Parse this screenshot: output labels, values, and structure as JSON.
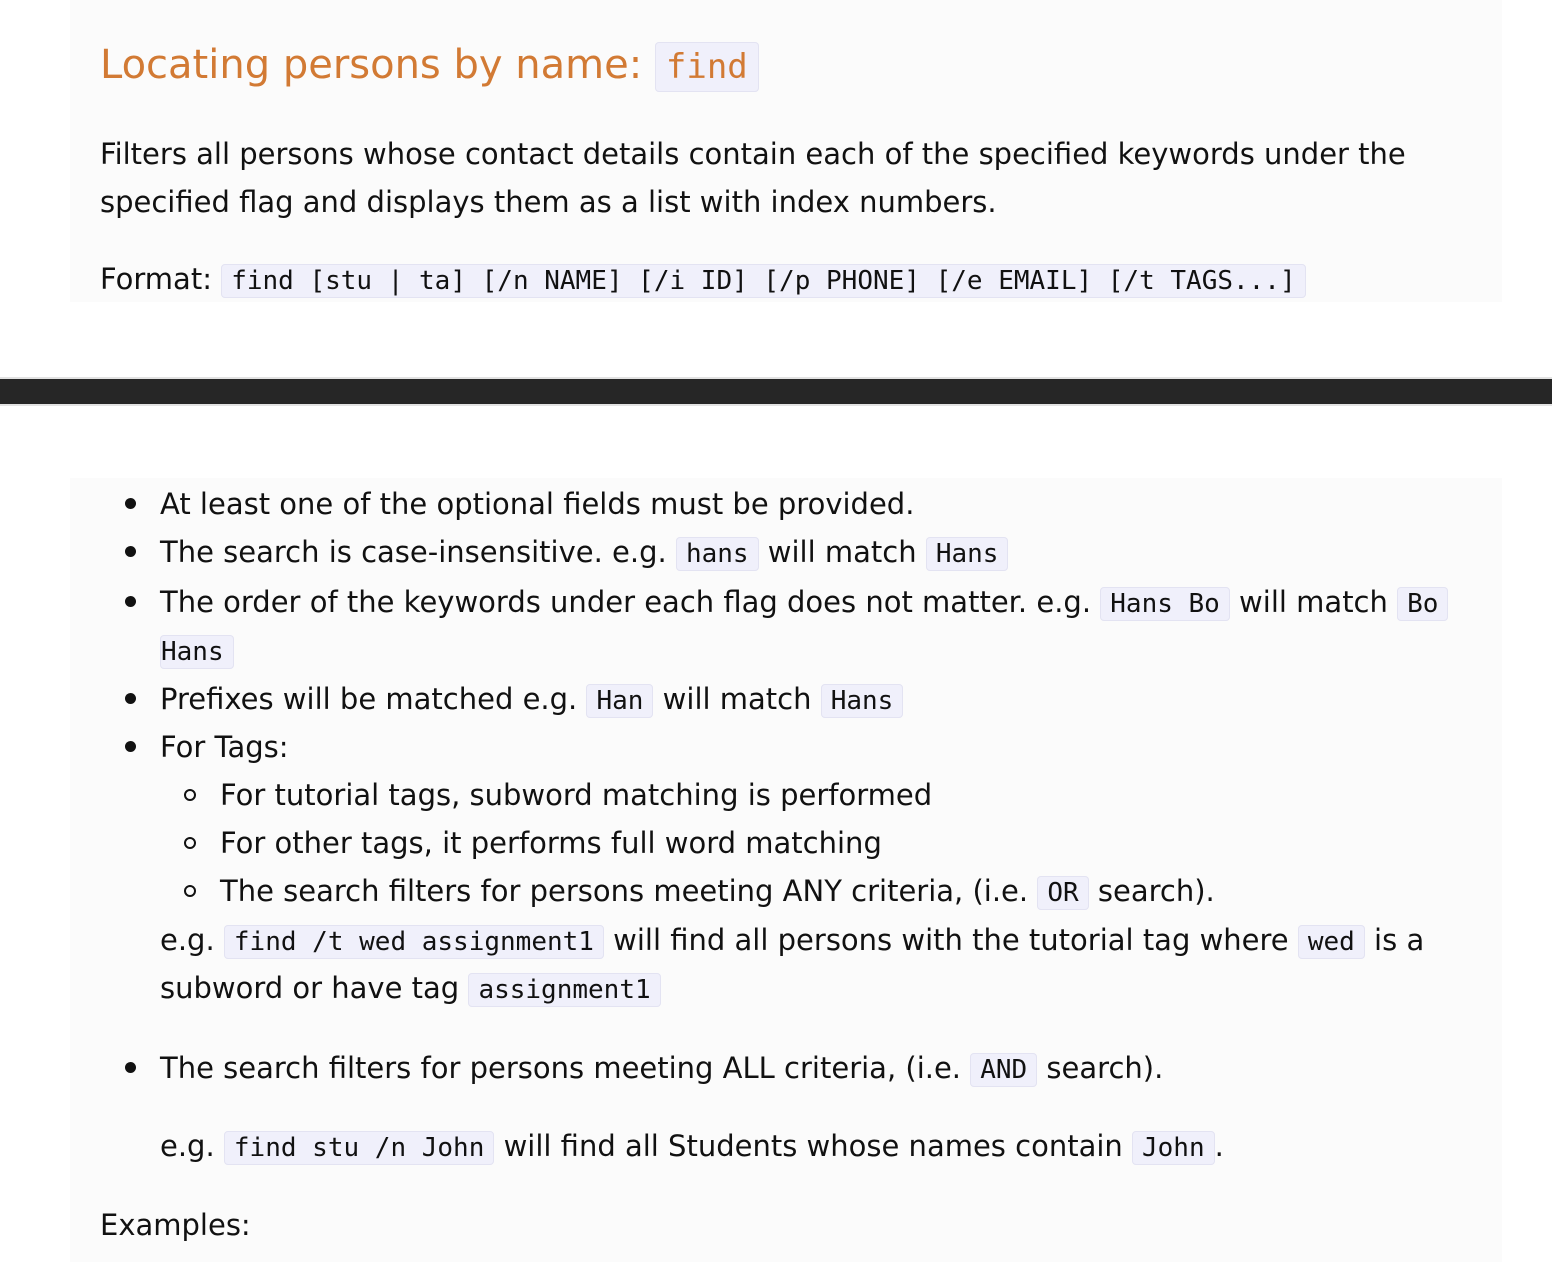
{
  "section": {
    "title": "Locating persons by name: ",
    "title_code": "find",
    "description_line1": "Filters all persons whose contact details contain each of the specified keywords under the",
    "description_line2": "specified flag and displays them as a list with index numbers.",
    "format_label": "Format: ",
    "format_code": "find [stu | ta] [/n NAME] [/i ID] [/p PHONE] [/e EMAIL] [/t TAGS...]"
  },
  "notes": {
    "item1": "At least one of the optional fields must be provided.",
    "item2": {
      "pre": "The search is case-insensitive. e.g. ",
      "code1": "hans",
      "mid": " will match ",
      "code2": "Hans"
    },
    "item3": {
      "pre": "The order of the keywords under each flag does not matter. e.g. ",
      "code1": "Hans Bo",
      "mid": " will match ",
      "code2a": "Bo",
      "code2b": "Hans"
    },
    "item4": {
      "pre": "Prefixes will be matched e.g. ",
      "code1": "Han",
      "mid": " will match ",
      "code2": "Hans"
    },
    "item5": {
      "label": "For Tags:",
      "sub1": "For tutorial tags, subword matching is performed",
      "sub2": "For other tags, it performs full word matching",
      "sub3_pre": "The search filters for persons meeting ANY criteria, (i.e. ",
      "sub3_code": "OR",
      "sub3_post": " search).",
      "eg_pre": "e.g. ",
      "eg_code": "find /t wed assignment1",
      "eg_mid": " will find all persons with the tutorial tag where ",
      "eg_code2": "wed",
      "eg_post": " is a",
      "eg_line2_pre": "subword or have tag ",
      "eg_code3": "assignment1"
    },
    "item6": {
      "pre": "The search filters for persons meeting ALL criteria, (i.e. ",
      "code": "AND",
      "post": " search).",
      "eg_pre": "e.g. ",
      "eg_code": "find stu /n John",
      "eg_mid": " will find all Students whose names contain ",
      "eg_code2": "John",
      "eg_post": "."
    }
  },
  "examples_label": "Examples:"
}
